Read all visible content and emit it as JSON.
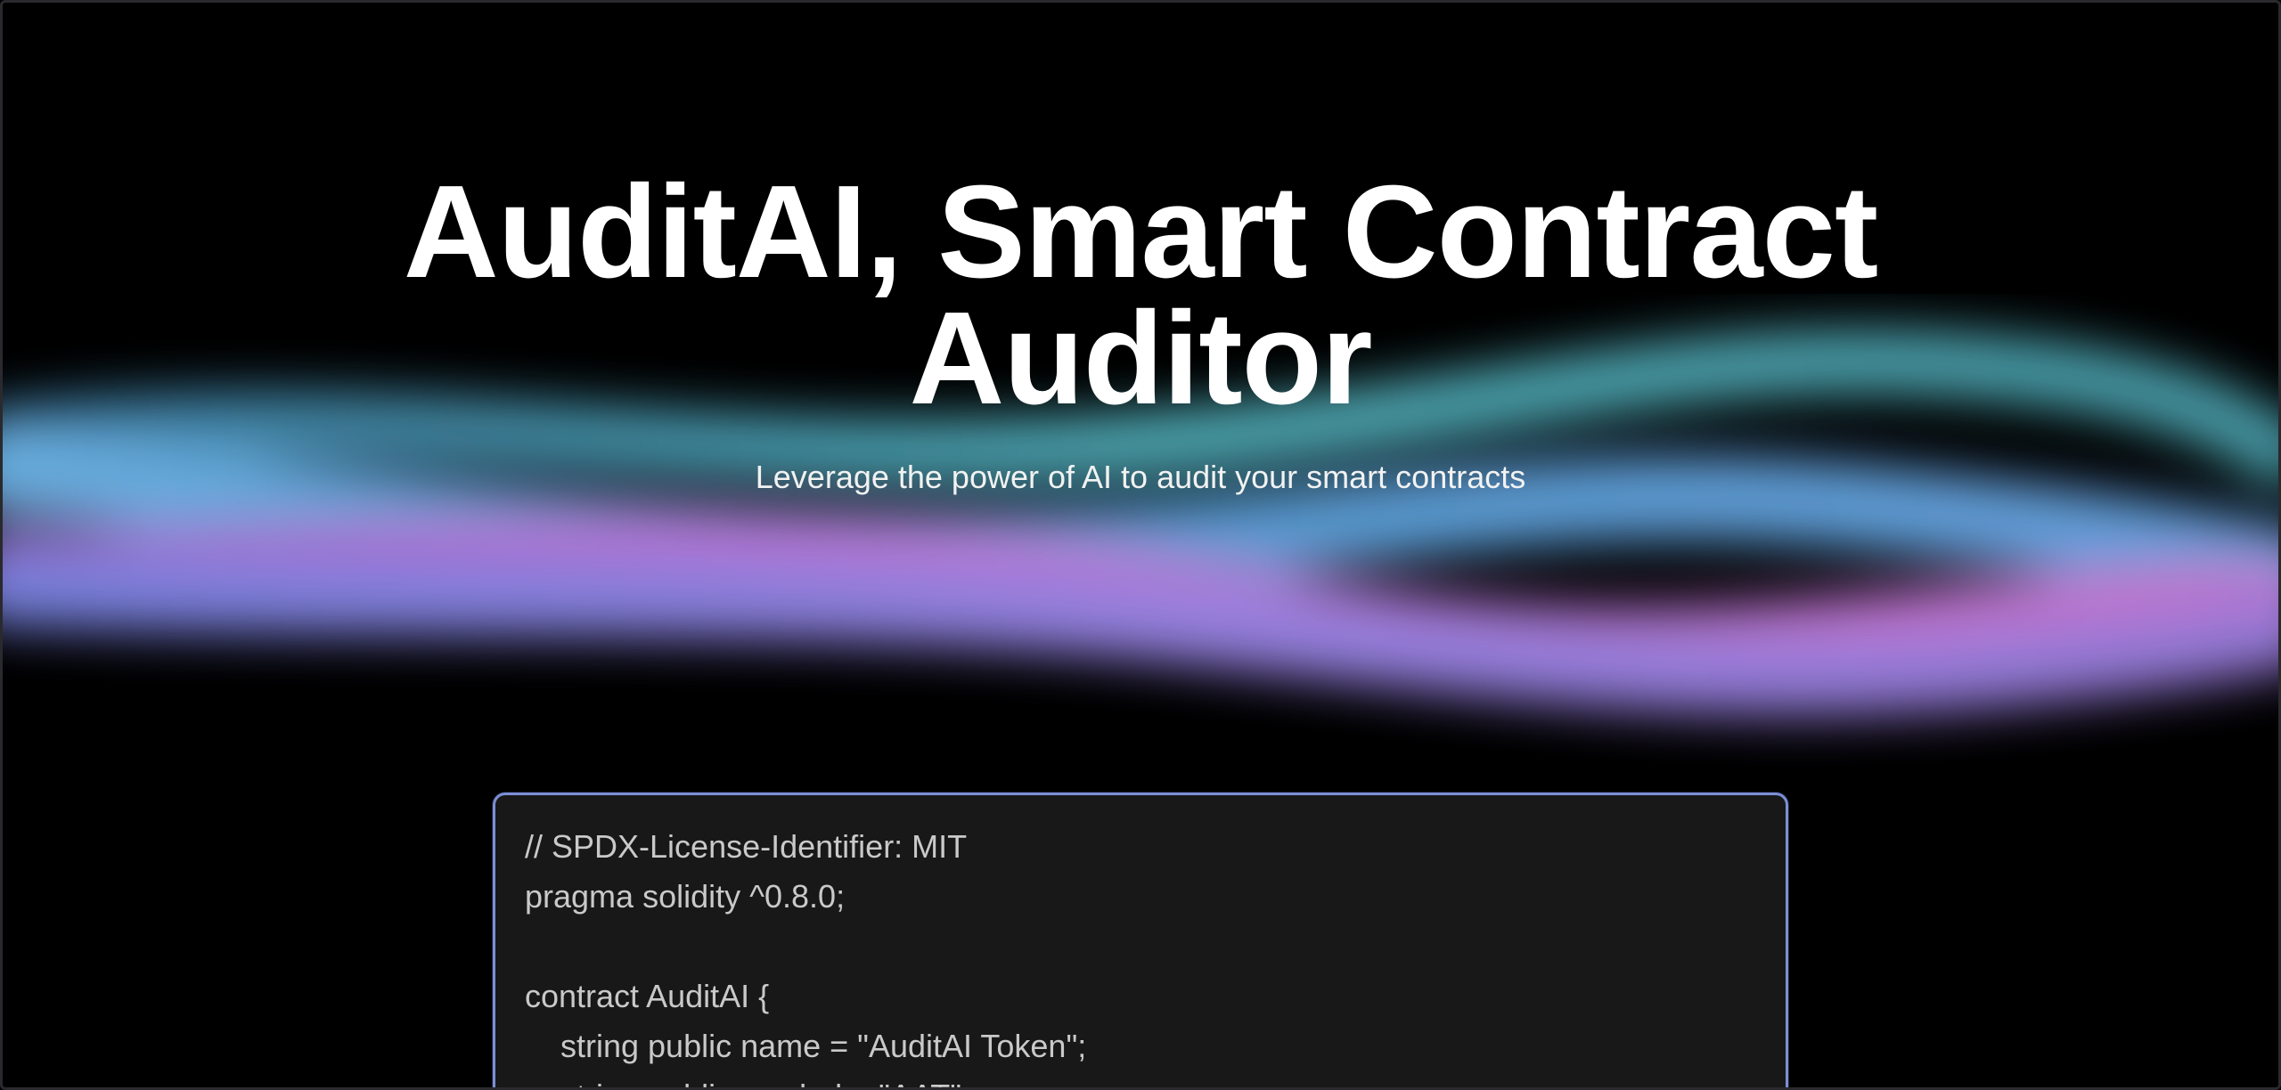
{
  "hero": {
    "title": "AuditAI, Smart Contract Auditor",
    "subtitle": "Leverage the power of AI to audit your smart contracts"
  },
  "editor": {
    "lines": [
      {
        "text": "// SPDX-License-Identifier: MIT",
        "indent": false
      },
      {
        "text": "pragma solidity ^0.8.0;",
        "indent": false
      },
      {
        "text": "",
        "indent": false
      },
      {
        "text": "contract AuditAI {",
        "indent": false
      },
      {
        "text": "string public name = \"AuditAI Token\";",
        "indent": true
      },
      {
        "text": "string public symbol = \"AAT\";",
        "indent": true
      }
    ]
  },
  "colors": {
    "background": "#000000",
    "editor_background": "#181818",
    "editor_border": "#7b8ed6",
    "aurora_blue": "#6fb6ea",
    "aurora_teal": "#55b8c4",
    "aurora_pink": "#c77ee0",
    "aurora_violet": "#9a86e8"
  }
}
